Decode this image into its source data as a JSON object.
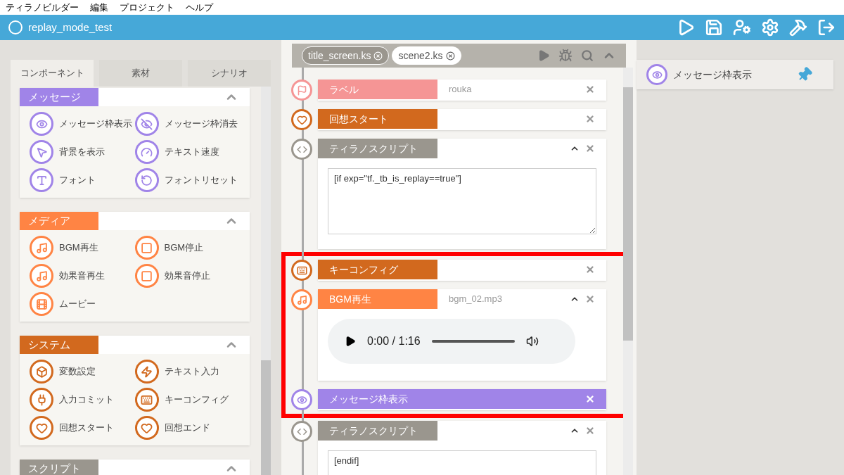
{
  "menu_bar": [
    "ティラノビルダー",
    "編集",
    "プロジェクト",
    "ヘルプ"
  ],
  "header": {
    "title": "replay_mode_test"
  },
  "left_panel": {
    "tabs": [
      {
        "label": "コンポーネント",
        "selected": true
      },
      {
        "label": "素材",
        "selected": false
      },
      {
        "label": "シナリオ",
        "selected": false
      }
    ],
    "sections": [
      {
        "title": "メッセージ",
        "color": "#a084e8",
        "expanded": true,
        "items": [
          {
            "label": "メッセージ枠表示",
            "kind": "msg-show"
          },
          {
            "label": "メッセージ枠消去",
            "kind": "msg-hide"
          },
          {
            "label": "背景を表示",
            "kind": "pointer"
          },
          {
            "label": "テキスト速度",
            "kind": "speed"
          },
          {
            "label": "フォント",
            "kind": "font"
          },
          {
            "label": "フォントリセット",
            "kind": "font-reset"
          }
        ]
      },
      {
        "title": "メディア",
        "color": "#ff8444",
        "expanded": true,
        "items": [
          {
            "label": "BGM再生",
            "kind": "play"
          },
          {
            "label": "BGM停止",
            "kind": "stop"
          },
          {
            "label": "効果音再生",
            "kind": "play"
          },
          {
            "label": "効果音停止",
            "kind": "stop"
          },
          {
            "label": "ムービー",
            "kind": "movie"
          }
        ]
      },
      {
        "title": "システム",
        "color": "#d2691e",
        "expanded": true,
        "items": [
          {
            "label": "変数設定",
            "kind": "box"
          },
          {
            "label": "テキスト入力",
            "kind": "bolt"
          },
          {
            "label": "入力コミット",
            "kind": "plug"
          },
          {
            "label": "キーコンフィグ",
            "kind": "keyboard"
          },
          {
            "label": "回想スタート",
            "kind": "heart"
          },
          {
            "label": "回想エンド",
            "kind": "heart"
          }
        ]
      },
      {
        "title": "スクリプト",
        "color": "#9a968e",
        "expanded": true
      }
    ]
  },
  "editor": {
    "file_tabs": [
      {
        "label": "title_screen.ks",
        "selected": true
      },
      {
        "label": "scene2.ks",
        "selected": false
      }
    ],
    "blocks": [
      {
        "title": "ラベル",
        "kind": "flag",
        "color": "#f59595",
        "value": "rouka",
        "expanded": false,
        "highlighted": false
      },
      {
        "title": "回想スタート",
        "kind": "heart",
        "color": "#d2691e",
        "expanded": false,
        "highlighted": false
      },
      {
        "title": "ティラノスクリプト",
        "kind": "script",
        "color": "#9a968e",
        "expanded": true,
        "highlighted": false,
        "body": {
          "kind": "code",
          "text": "[if exp=\"tf._tb_is_replay==true\"]"
        }
      },
      {
        "title": "キーコンフィグ",
        "kind": "keyboard",
        "color": "#d2691e",
        "expanded": false,
        "highlighted": true
      },
      {
        "title": "BGM再生",
        "kind": "play",
        "color": "#ff8444",
        "value": "bgm_02.mp3",
        "expanded": true,
        "highlighted": true,
        "body": {
          "kind": "audio",
          "time": "0:00 / 1:16"
        }
      },
      {
        "title": "メッセージ枠表示",
        "kind": "msg-show",
        "color": "#a084e8",
        "expanded": false,
        "highlighted": true,
        "full": true
      },
      {
        "title": "ティラノスクリプト",
        "kind": "script",
        "color": "#9a968e",
        "expanded": true,
        "highlighted": false,
        "body": {
          "kind": "code",
          "text": "[endif]"
        }
      }
    ]
  },
  "right_panel": {
    "title": "メッセージ枠表示",
    "kind": "msg-show"
  }
}
